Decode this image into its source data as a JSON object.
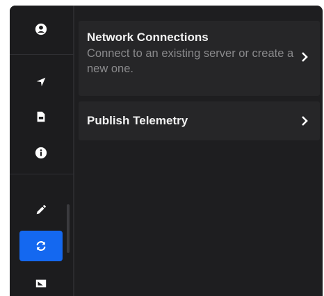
{
  "sidebar": {
    "items": [
      {
        "name": "account",
        "icon": "user-circle-icon",
        "active": false
      },
      {
        "name": "navigate",
        "icon": "location-arrow-icon",
        "active": false
      },
      {
        "name": "files",
        "icon": "file-icon",
        "active": false
      },
      {
        "name": "about",
        "icon": "info-circle-icon",
        "active": false
      },
      {
        "name": "tools",
        "icon": "eyedropper-icon",
        "active": false
      },
      {
        "name": "sync",
        "icon": "sync-icon",
        "active": true
      },
      {
        "name": "display",
        "icon": "image-icon",
        "active": false
      }
    ],
    "active_color": "#1468f0"
  },
  "main": {
    "cards": [
      {
        "title": "Network Connections",
        "subtitle": "Connect to an existing server or create a new one.",
        "icon": "chevron-right-icon"
      },
      {
        "title": "Publish Telemetry",
        "icon": "chevron-right-icon"
      }
    ]
  }
}
